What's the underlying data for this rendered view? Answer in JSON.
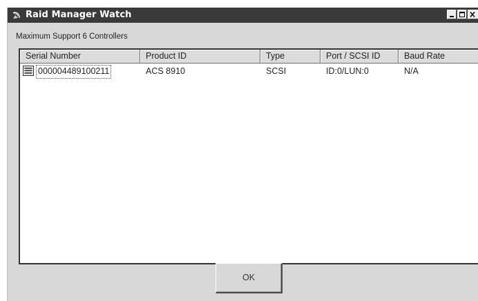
{
  "window": {
    "title": "Raid Manager Watch",
    "icon": "satellite-dish-icon"
  },
  "caption": "Maximum Support 6 Controllers",
  "list": {
    "columns": [
      "Serial Number",
      "Product ID",
      "Type",
      "Port / SCSI ID",
      "Baud Rate"
    ],
    "rows": [
      {
        "icon": "controller-icon",
        "serial": "000004489100211",
        "product_id": "ACS 8910",
        "type": "SCSI",
        "port_scsi_id": "ID:0/LUN:0",
        "baud_rate": "N/A"
      }
    ]
  },
  "buttons": {
    "ok_label": "OK"
  },
  "colors": {
    "titlebar": "#3a3a3a",
    "dialog_bg": "#d8d8d8",
    "list_bg": "#ffffff"
  }
}
